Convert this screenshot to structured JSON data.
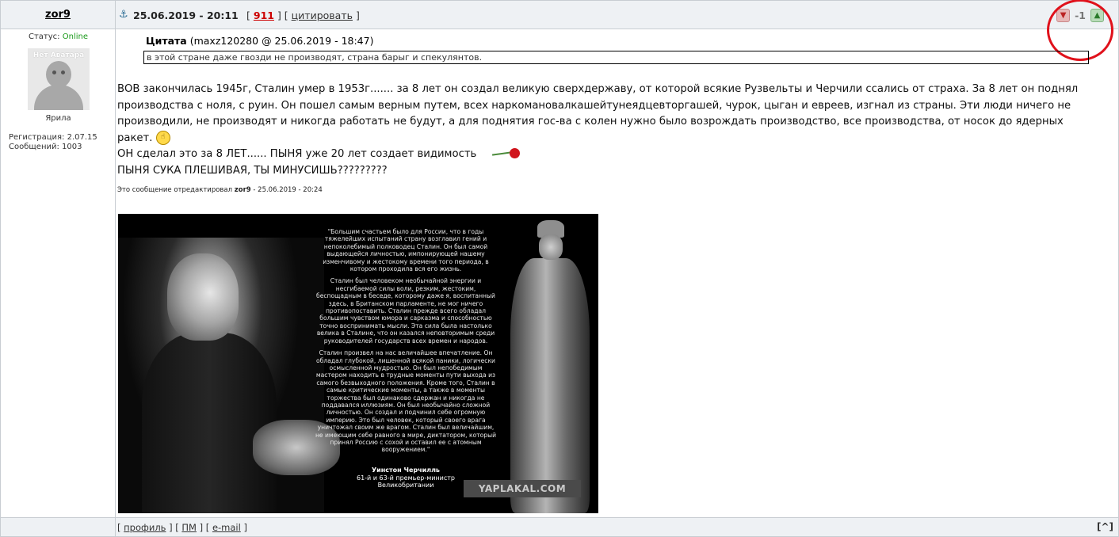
{
  "post": {
    "author": "zor9",
    "date": "25.06.2019 - 20:11",
    "reply_open": "[",
    "post_number": "911",
    "sep": "] [",
    "cite_label": "цитировать",
    "reply_close": "]",
    "rating": {
      "score": "-1",
      "minus_icon": "thumbs-down-icon",
      "plus_icon": "thumbs-up-icon"
    },
    "highlight_color": "#e0111b"
  },
  "user": {
    "status_label": "Статус:",
    "status_value": "Online",
    "avatar_text": "Нет Аватара",
    "rank": "Ярила",
    "registration": "Регистрация: 2.07.15",
    "messages": "Сообщений: 1003"
  },
  "quote": {
    "label": "Цитата",
    "source": "(maxz120280 @ 25.06.2019 - 18:47)",
    "text": "в этой стране даже гвозди не производят, страна барыг и спекулянтов."
  },
  "body": {
    "line1": "ВОВ закончилась 1945г, Сталин умер в 1953г....... за 8 лет он создал великую сверхдержаву, от которой всякие Рузвельты и Черчили ссались от страха. За 8 лет он поднял производства с ноля, с руин. Он пошел самым верным путем, всех наркомановалкашейтунеядцевторгашей, чурок, цыган и евреев, изгнал из страны. Эти люди ничего не производили, не производят и никогда работать не будут, а для поднятия гос-ва с колен нужно было возрождать производство, все производства, от носок до ядерных ракет.",
    "line2": "ОН сделал это за 8 ЛЕТ...... ПЫНЯ уже 20 лет создает видимость",
    "line3": "ПЫНЯ СУКА ПЛЕШИВАЯ, ТЫ МИНУСИШЬ?????????",
    "edited_prefix": "Это сообщение отредактировал",
    "edited_user": "zor9",
    "edited_date": "- 25.06.2019 - 20:24"
  },
  "image": {
    "quote_p1": "\"Большим счастьем было для России, что в годы тяжелейших испытаний страну возглавил гений и непоколебимый полководец Сталин. Он был самой выдающейся личностью, импонирующей нашему изменчивому и жестокому времени того периода, в котором проходила вся его жизнь.",
    "quote_p2": "Сталин был человеком необычайной энергии и несгибаемой силы воли, резким, жестоким, беспощадным в беседе, которому даже я, воспитанный здесь, в Британском парламенте, не мог ничего противопоставить. Сталин прежде всего обладал большим чувством юмора и сарказма и способностью точно воспринимать мысли. Эта сила была настолько велика в Сталине, что он казался неповторимым среди руководителей государств всех времен и народов.",
    "quote_p3": "Сталин произвел на нас величайшее впечатление. Он обладал глубокой, лишенной всякой паники, логически осмысленной мудростью. Он был непобедимым мастером находить в трудные моменты пути выхода из самого безвыходного положения. Кроме того, Сталин в самые критические моменты, а также в моменты торжества был одинаково сдержан и никогда не поддавался иллюзиям. Он был необычайно сложной личностью. Он создал и подчинил себе огромную империю. Это был человек, который своего врага уничтожал своим же врагом. Сталин был величайшим, не имеющим себе равного в мире, диктатором, который принял Россию с сохой и оставил ее с атомным вооружением.\"",
    "sig_name": "Уинстон Черчилль",
    "sig_line2": "61-й и 63-й премьер-министр",
    "sig_line3": "Великобритании",
    "watermark": "YAPLAKAL.COM"
  },
  "footer": {
    "l1": "[",
    "profile": "профиль",
    "l2": "] [",
    "pm": "ПМ",
    "l3": "] [",
    "email": "e-mail",
    "l4": "]",
    "to_top": "[^]"
  }
}
